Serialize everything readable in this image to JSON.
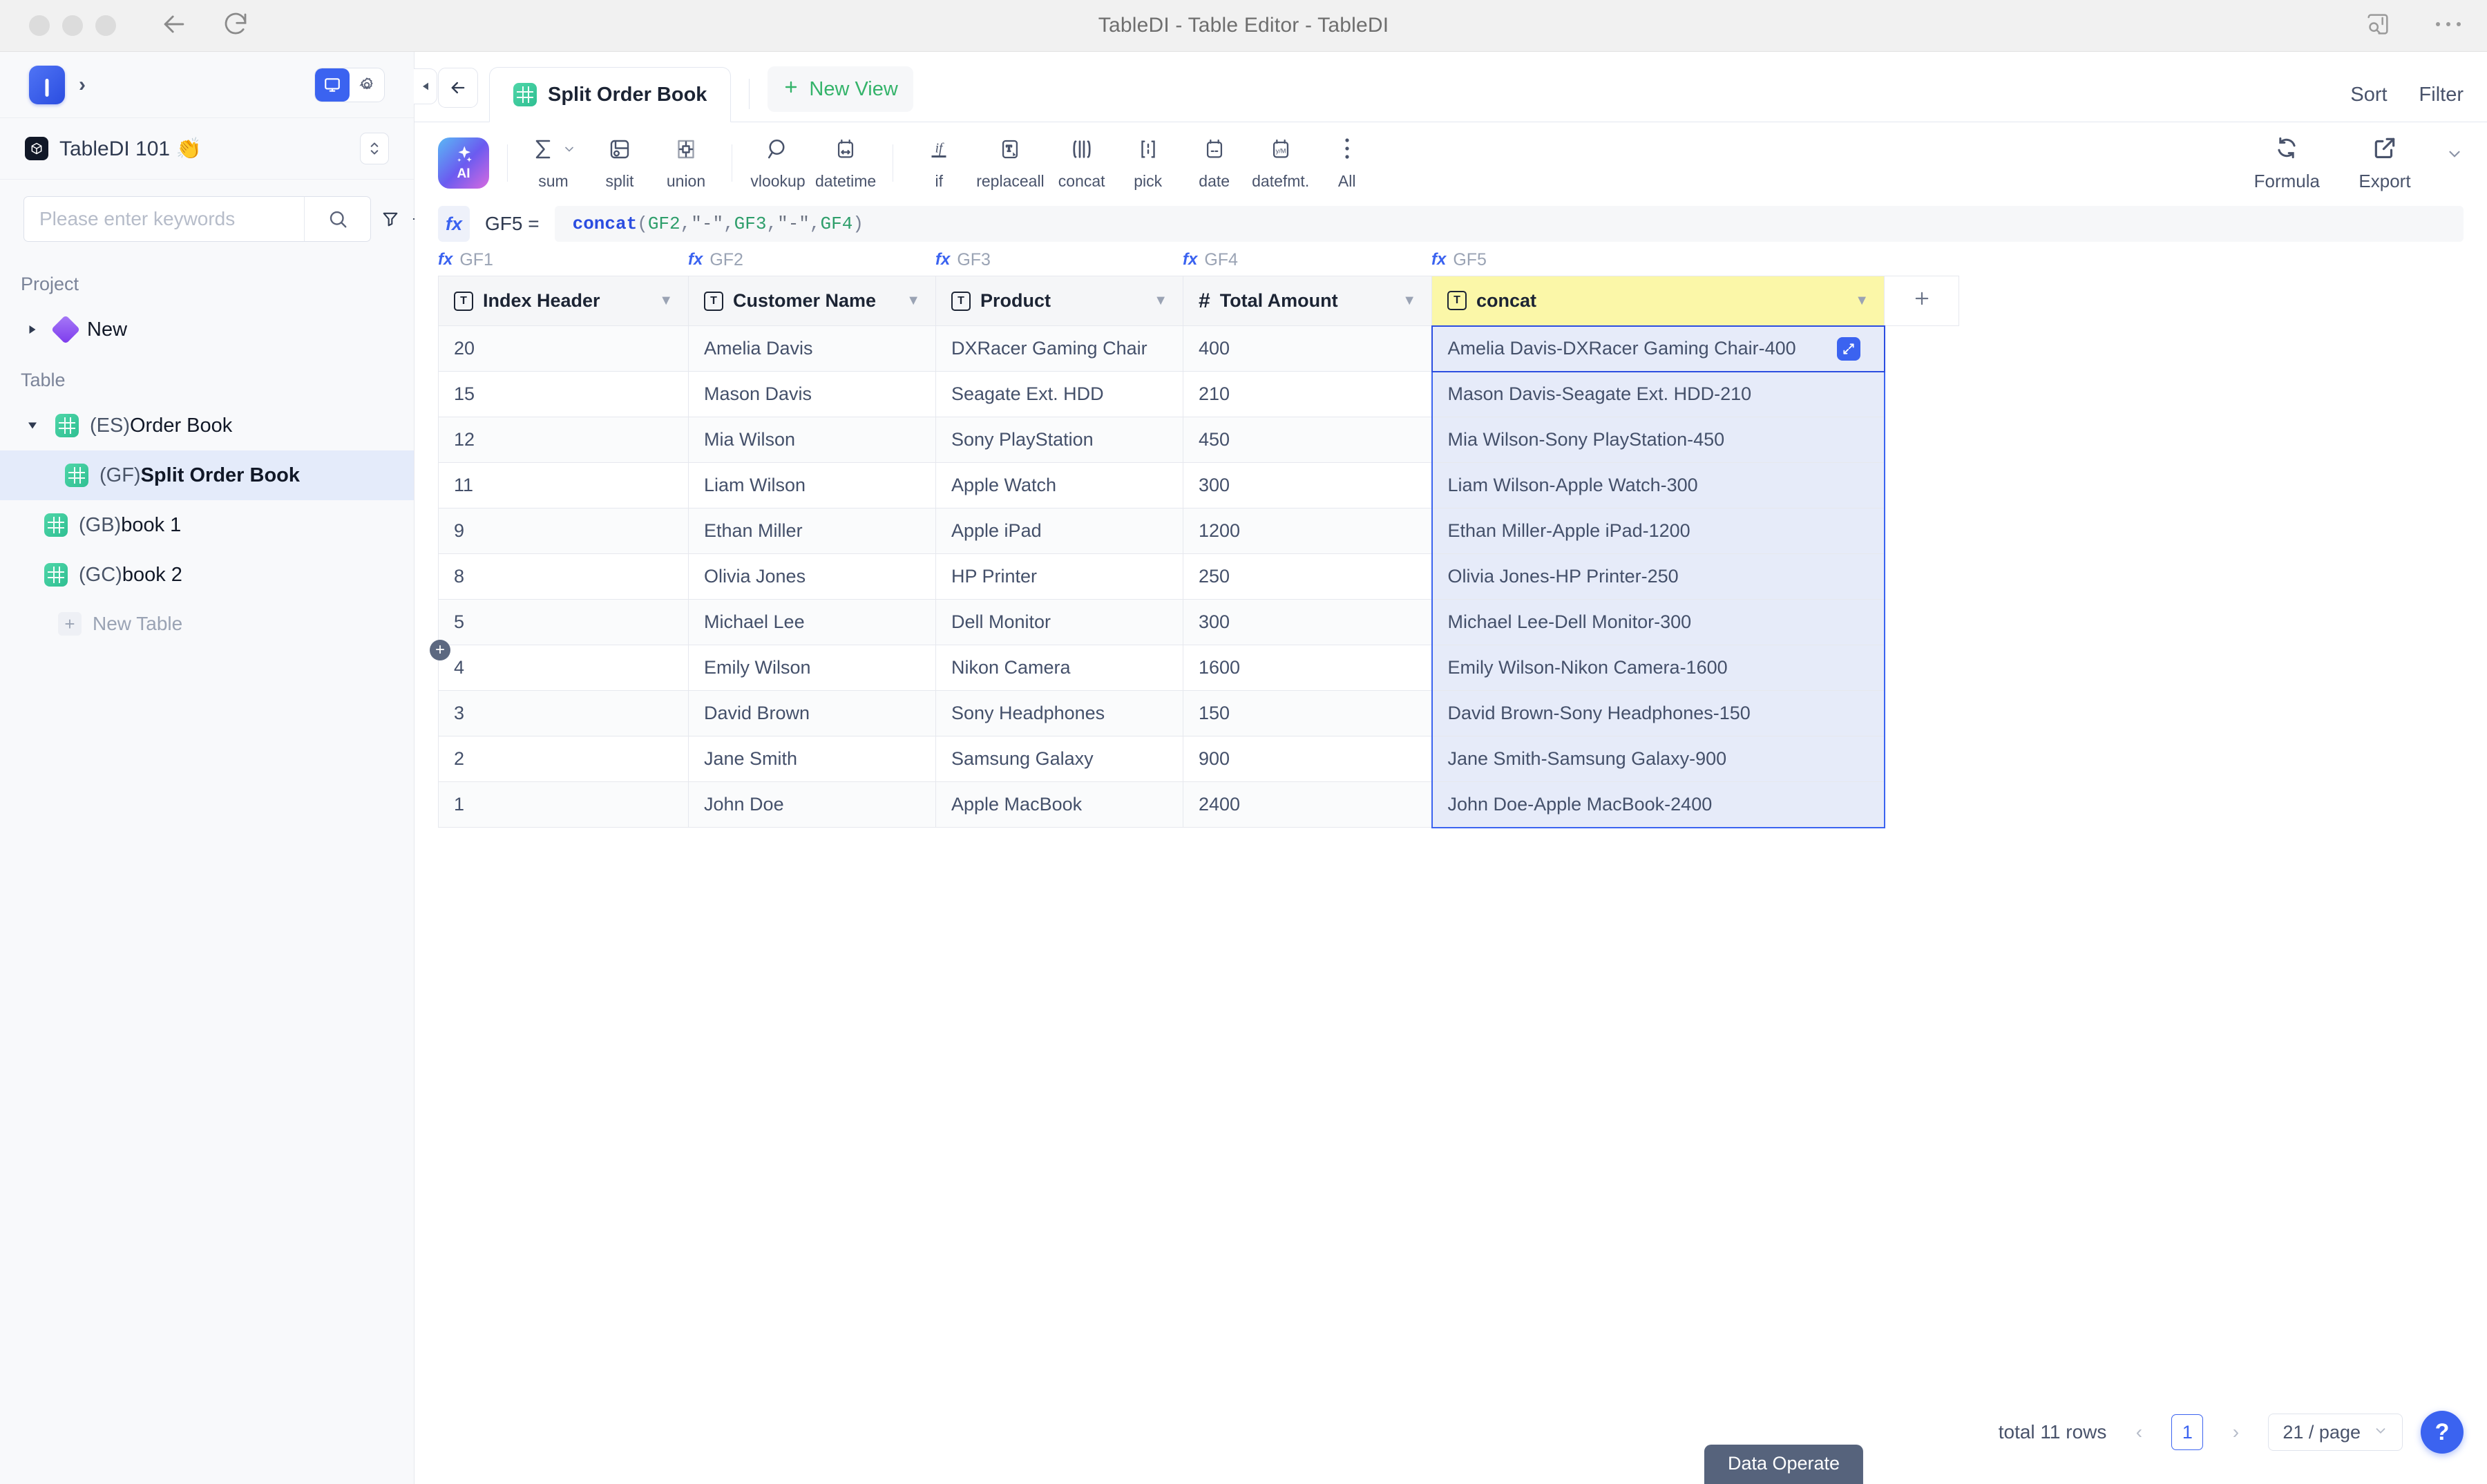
{
  "window": {
    "title": "TableDI - Table Editor - TableDI",
    "back_icon": "back-arrow-icon",
    "reload_icon": "reload-icon",
    "note_search_icon": "note-search-icon",
    "more_icon": "more-horizontal-icon"
  },
  "sidebar": {
    "logo_label": "I",
    "expand_icon": "chevron-right-icon",
    "view_toggle": {
      "monitor_icon": "monitor-icon",
      "gear_icon": "gear-icon"
    },
    "project": {
      "name": "TableDI 101 👏",
      "switch_icon": "updown-chevrons-icon"
    },
    "search": {
      "placeholder": "Please enter keywords",
      "value": "",
      "search_icon": "search-icon",
      "filter_icon": "funnel-icon",
      "add_icon": "plus-icon"
    },
    "section_project": "Project",
    "section_table": "Table",
    "project_items": [
      {
        "label": "New",
        "icon": "diamond-icon",
        "expanded": false
      }
    ],
    "table_items": [
      {
        "code": "(ES)",
        "label": "Order Book",
        "expanded": true,
        "selected": false,
        "indent": 0
      },
      {
        "code": "(GF)",
        "label": "Split Order Book",
        "expanded": null,
        "selected": true,
        "indent": 1
      },
      {
        "code": "(GB)",
        "label": "book 1",
        "expanded": null,
        "selected": false,
        "indent": 0
      },
      {
        "code": "(GC)",
        "label": "book 2",
        "expanded": null,
        "selected": false,
        "indent": 0
      }
    ],
    "new_table_label": "New Table"
  },
  "viewbar": {
    "back_icon": "back-arrow-icon",
    "tab_label": "Split Order Book",
    "tab_icon": "table-icon",
    "new_view_label": "New View",
    "new_view_icon": "plus-icon",
    "sort_label": "Sort",
    "filter_label": "Filter",
    "collapse_icon": "collapse-left-icon"
  },
  "toolbar": {
    "ai_label": "AI",
    "tools": [
      {
        "label": "sum",
        "icon": "sigma-icon",
        "has_dropdown": true
      },
      {
        "label": "split",
        "icon": "split-icon",
        "has_dropdown": false
      },
      {
        "label": "union",
        "icon": "union-icon",
        "has_dropdown": false
      },
      {
        "label": "vlookup",
        "icon": "magnifier-icon",
        "has_dropdown": false
      },
      {
        "label": "datetime",
        "icon": "datetime-icon",
        "has_dropdown": false
      },
      {
        "label": "if",
        "icon": "if-icon",
        "has_dropdown": false
      },
      {
        "label": "replaceall",
        "icon": "replace-icon",
        "has_dropdown": false
      },
      {
        "label": "concat",
        "icon": "concat-icon",
        "has_dropdown": false
      },
      {
        "label": "pick",
        "icon": "pick-icon",
        "has_dropdown": false
      },
      {
        "label": "date",
        "icon": "date-icon",
        "has_dropdown": false
      },
      {
        "label": "datefmt.",
        "icon": "datefmt-icon",
        "has_dropdown": false
      },
      {
        "label": "All",
        "icon": "more-vertical-icon",
        "has_dropdown": false
      }
    ],
    "formula_label": "Formula",
    "formula_icon": "refresh-icon",
    "export_label": "Export",
    "export_icon": "export-icon",
    "export_caret_icon": "chevron-down-icon"
  },
  "formula_bar": {
    "fx_label": "fx",
    "cell_ref": "GF5 =",
    "function_name": "concat",
    "open_paren": "(",
    "close_paren": ")",
    "args": [
      "GF2",
      "\"-\"",
      "GF3",
      "\"-\"",
      "GF4"
    ]
  },
  "table": {
    "column_codes": [
      "GF1",
      "GF2",
      "GF3",
      "GF4",
      "GF5"
    ],
    "columns": [
      {
        "name": "Index Header",
        "type_icon": "text-type-icon",
        "code": "GF1",
        "highlight": false
      },
      {
        "name": "Customer Name",
        "type_icon": "text-type-icon",
        "code": "GF2",
        "highlight": false
      },
      {
        "name": "Product",
        "type_icon": "text-type-icon",
        "code": "GF3",
        "highlight": false
      },
      {
        "name": "Total Amount",
        "type_icon": "number-type-icon",
        "code": "GF4",
        "highlight": false
      },
      {
        "name": "concat",
        "type_icon": "text-type-icon",
        "code": "GF5",
        "highlight": true
      }
    ],
    "add_column_icon": "plus-icon",
    "add_row_icon": "plus-circle-icon",
    "expand_cell_icon": "expand-cell-icon",
    "rows": [
      {
        "index": "20",
        "customer": "Amelia Davis",
        "product": "DXRacer Gaming Chair",
        "amount": "400",
        "concat": "Amelia Davis-DXRacer Gaming Chair-400"
      },
      {
        "index": "15",
        "customer": "Mason Davis",
        "product": "Seagate Ext. HDD",
        "amount": "210",
        "concat": "Mason Davis-Seagate Ext. HDD-210"
      },
      {
        "index": "12",
        "customer": "Mia Wilson",
        "product": "Sony PlayStation",
        "amount": "450",
        "concat": "Mia Wilson-Sony PlayStation-450"
      },
      {
        "index": "11",
        "customer": "Liam Wilson",
        "product": "Apple Watch",
        "amount": "300",
        "concat": "Liam Wilson-Apple Watch-300"
      },
      {
        "index": "9",
        "customer": "Ethan Miller",
        "product": "Apple iPad",
        "amount": "1200",
        "concat": "Ethan Miller-Apple iPad-1200"
      },
      {
        "index": "8",
        "customer": "Olivia Jones",
        "product": "HP Printer",
        "amount": "250",
        "concat": "Olivia Jones-HP Printer-250"
      },
      {
        "index": "5",
        "customer": "Michael Lee",
        "product": "Dell Monitor",
        "amount": "300",
        "concat": "Michael Lee-Dell Monitor-300"
      },
      {
        "index": "4",
        "customer": "Emily Wilson",
        "product": "Nikon Camera",
        "amount": "1600",
        "concat": "Emily Wilson-Nikon Camera-1600"
      },
      {
        "index": "3",
        "customer": "David Brown",
        "product": "Sony Headphones",
        "amount": "150",
        "concat": "David Brown-Sony Headphones-150"
      },
      {
        "index": "2",
        "customer": "Jane Smith",
        "product": "Samsung Galaxy",
        "amount": "900",
        "concat": "Jane Smith-Samsung Galaxy-900"
      },
      {
        "index": "1",
        "customer": "John Doe",
        "product": "Apple MacBook",
        "amount": "2400",
        "concat": "John Doe-Apple MacBook-2400"
      }
    ]
  },
  "footer": {
    "total_label": "total 11 rows",
    "prev_icon": "chevron-left-icon",
    "next_icon": "chevron-right-icon",
    "page_number": "1",
    "page_size": "21 / page",
    "page_size_caret": "chevron-down-icon",
    "help_label": "?",
    "data_operate_label": "Data Operate"
  },
  "colors": {
    "accent": "#3b63f0",
    "highlight_header": "#fbf7a8",
    "selection_fill": "#e6ebf9",
    "green": "#34b36a",
    "sidebar_bg": "#f8f9fb"
  }
}
